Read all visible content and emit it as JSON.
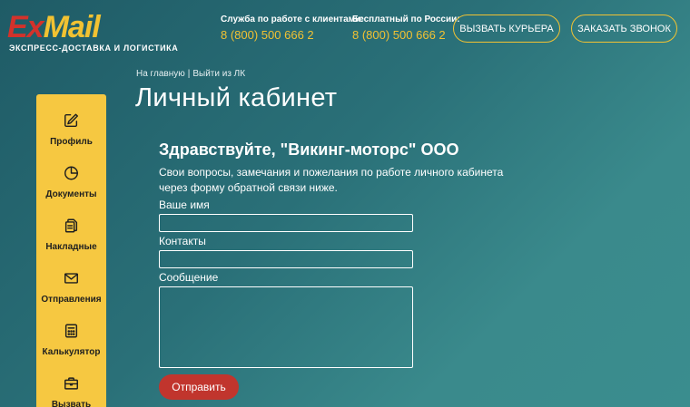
{
  "header": {
    "logo_ex": "Ex",
    "logo_mail": "Mail",
    "tagline": "ЭКСПРЕСС-ДОСТАВКА И ЛОГИСТИКА",
    "contacts": [
      {
        "label": "Служба по работе с клиентами:",
        "phone": "8 (800) 500 666 2"
      },
      {
        "label": "Бесплатный по России:",
        "phone": "8 (800) 500 666 2"
      }
    ],
    "courier_button": "ВЫЗВАТЬ КУРЬЕРА",
    "callback_button": "ЗАКАЗАТЬ ЗВОНОК"
  },
  "breadcrumb": {
    "home": "На главную",
    "separator": "|",
    "logout": "Выйти из ЛК"
  },
  "page_title": "Личный кабинет",
  "sidebar": {
    "items": [
      {
        "label": "Профиль",
        "icon": "edit-icon"
      },
      {
        "label": "Документы",
        "icon": "pie-chart-icon"
      },
      {
        "label": "Накладные",
        "icon": "copy-icon"
      },
      {
        "label": "Отправления",
        "icon": "envelope-icon"
      },
      {
        "label": "Калькулятор",
        "icon": "calculator-icon"
      },
      {
        "label": "Вызвать",
        "icon": "briefcase-icon"
      }
    ]
  },
  "form": {
    "greeting": "Здравствуйте, \"Викинг-моторс\" ООО",
    "intro": "Свои вопросы, замечания и пожелания по работе личного кабинета через форму обратной связи ниже.",
    "name_label": "Ваше имя",
    "name_value": "",
    "contacts_label": "Контакты",
    "contacts_value": "",
    "message_label": "Сообщение",
    "message_value": "",
    "submit_label": "Отправить"
  },
  "colors": {
    "accent_yellow": "#f6c841",
    "brand_red": "#c1352d",
    "background": "#2a7078"
  }
}
